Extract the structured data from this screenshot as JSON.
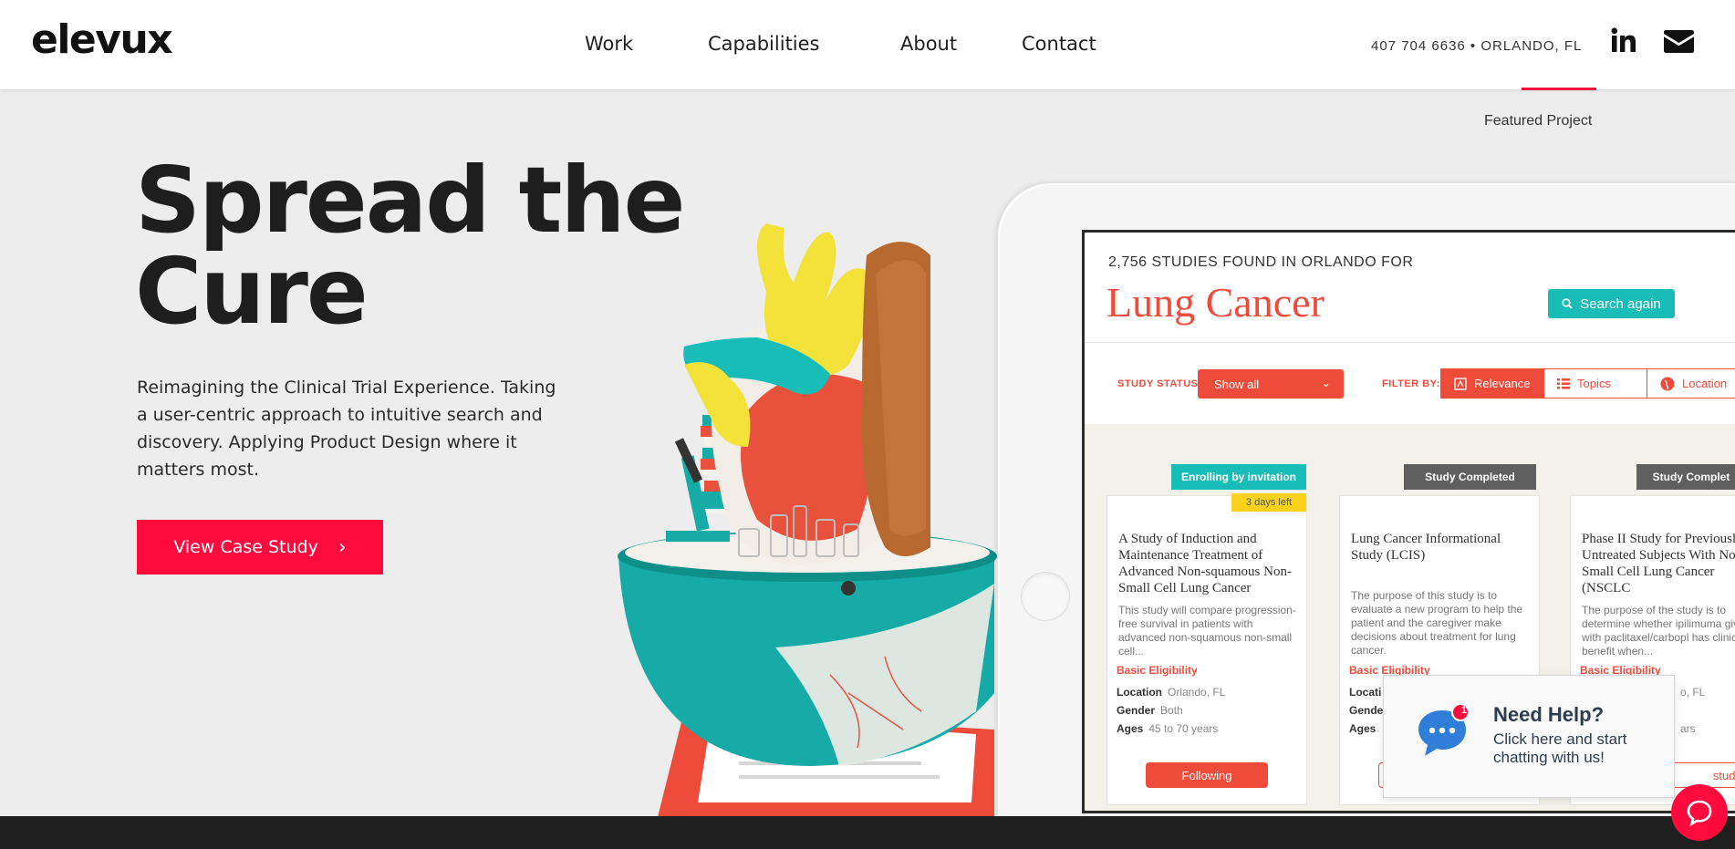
{
  "header": {
    "logo": "elevux",
    "nav": [
      {
        "label": "Work"
      },
      {
        "label": "Capabilities"
      },
      {
        "label": "About"
      },
      {
        "label": "Contact"
      }
    ],
    "contact": "407 704 6636 • ORLANDO, FL",
    "icons": [
      "linkedin-icon",
      "mail-icon"
    ]
  },
  "hero": {
    "label": "Featured Project",
    "title_line1": "Spread the",
    "title_line2": "Cure",
    "description": "Reimagining the Clinical Trial Experience. Taking a user-centric approach to intuitive search and discovery. Applying Product Design where it matters most.",
    "cta": "View Case Study",
    "cta_arrow": "›"
  },
  "mockup": {
    "found": "2,756 STUDIES FOUND IN ORLANDO FOR",
    "query": "Lung Cancer",
    "search_again": "Search again",
    "study_status_label": "STUDY STATUS:",
    "study_status_value": "Show all",
    "filter_by_label": "FILTER BY:",
    "filters": [
      "Relevance",
      "Topics",
      "Location"
    ],
    "cards": [
      {
        "tag": "Enrolling by invitation",
        "days": "3 days left",
        "title": "A Study of Induction and Maintenance Treatment of Advanced Non-squamous Non-Small Cell Lung Cancer",
        "desc": "This study will compare progression-free survival in patients with advanced non-squamous non-small cell...",
        "eligibility": "Basic Eligibility",
        "location_label": "Location",
        "location": "Orlando, FL",
        "gender_label": "Gender",
        "gender": "Both",
        "ages_label": "Ages",
        "ages": "45 to 70 years",
        "button": "Following"
      },
      {
        "tag": "Study Completed",
        "title": "Lung Cancer Informational Study (LCIS)",
        "desc": "The purpose of this study is to evaluate a new program to help the patient and the caregiver make decisions about treatment for lung cancer.",
        "eligibility": "Basic Eligibility",
        "location_label": "Locati",
        "gender_label": "Gende",
        "ages_label": "Ages"
      },
      {
        "tag": "Study Complet",
        "title": "Phase II Study for Previously Untreated Subjects With Non Small Cell Lung Cancer (NSCLC",
        "desc": "The purpose of the study is to determine whether ipilimuma given with paclitaxel/carbopl has clinical benefit when...",
        "eligibility": "Basic Eligibility",
        "location": "o, FL",
        "ages": "ars",
        "button": "study"
      }
    ]
  },
  "help": {
    "title": "Need Help?",
    "text": "Click here and start chatting with us!",
    "badge": "1"
  },
  "colors": {
    "brand_red": "#ff0a3c",
    "coral": "#ef4b3b",
    "teal": "#18bdb8",
    "gray_tag": "#5f5f5f",
    "yellow": "#f8d21c"
  }
}
